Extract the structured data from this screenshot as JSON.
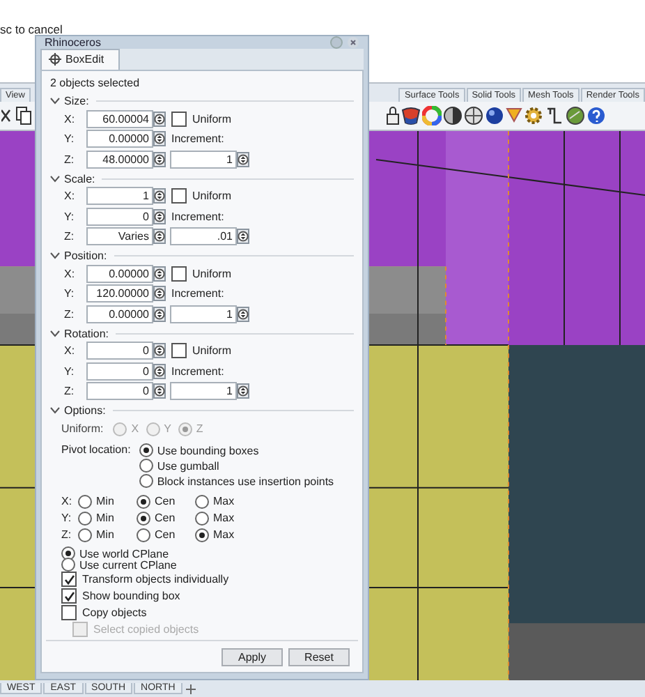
{
  "command_line": {
    "prompt": "sc to cancel"
  },
  "toolbar_tabs": [
    {
      "label": "View",
      "selected": false
    },
    {
      "label": "Surface Tools",
      "selected": false
    },
    {
      "label": "Solid Tools",
      "selected": false
    },
    {
      "label": "Mesh Tools",
      "selected": false
    },
    {
      "label": "Render Tools",
      "selected": false
    }
  ],
  "viewport_tabs": [
    {
      "label": "WEST",
      "selected": false
    },
    {
      "label": "EAST",
      "selected": false
    },
    {
      "label": "SOUTH",
      "selected": false
    },
    {
      "label": "NORTH",
      "selected": false
    }
  ],
  "dialog": {
    "title": "Rhinoceros",
    "tab": "BoxEdit",
    "selection_info": "2 objects selected",
    "sections": [
      {
        "title": "Size:",
        "expanded": true,
        "uniform_label": "Uniform",
        "uniform_checked": false,
        "increment_label": "Increment:",
        "increment": "1",
        "fields": [
          {
            "label": "X:",
            "value": "60.00004"
          },
          {
            "label": "Y:",
            "value": "0.00000"
          },
          {
            "label": "Z:",
            "value": "48.00000"
          }
        ]
      },
      {
        "title": "Scale:",
        "expanded": true,
        "uniform_label": "Uniform",
        "uniform_checked": false,
        "increment_label": "Increment:",
        "increment": ".01",
        "fields": [
          {
            "label": "X:",
            "value": "1"
          },
          {
            "label": "Y:",
            "value": "0"
          },
          {
            "label": "Z:",
            "value": "Varies"
          }
        ]
      },
      {
        "title": "Position:",
        "expanded": true,
        "uniform_label": "Uniform",
        "uniform_checked": false,
        "increment_label": "Increment:",
        "increment": "1",
        "fields": [
          {
            "label": "X:",
            "value": "0.00000"
          },
          {
            "label": "Y:",
            "value": "120.00000"
          },
          {
            "label": "Z:",
            "value": "0.00000"
          }
        ]
      },
      {
        "title": "Rotation:",
        "expanded": true,
        "uniform_label": "Uniform",
        "uniform_checked": false,
        "increment_label": "Increment:",
        "increment": "1",
        "fields": [
          {
            "label": "X:",
            "value": "0"
          },
          {
            "label": "Y:",
            "value": "0"
          },
          {
            "label": "Z:",
            "value": "0"
          }
        ]
      }
    ],
    "options": {
      "title": "Options:",
      "expanded": true,
      "uniform": {
        "label": "Uniform:",
        "disabled": true,
        "choices": [
          {
            "label": "X",
            "selected": false
          },
          {
            "label": "Y",
            "selected": false
          },
          {
            "label": "Z",
            "selected": true
          }
        ]
      },
      "pivot": {
        "label": "Pivot location:",
        "choices": [
          {
            "label": "Use bounding boxes",
            "selected": true
          },
          {
            "label": "Use gumball",
            "selected": false
          },
          {
            "label": "Block instances use insertion points",
            "selected": false
          }
        ]
      },
      "axes": [
        {
          "label": "X:",
          "choices": [
            {
              "label": "Min",
              "selected": false
            },
            {
              "label": "Cen",
              "selected": true
            },
            {
              "label": "Max",
              "selected": false
            }
          ]
        },
        {
          "label": "Y:",
          "choices": [
            {
              "label": "Min",
              "selected": false
            },
            {
              "label": "Cen",
              "selected": true
            },
            {
              "label": "Max",
              "selected": false
            }
          ]
        },
        {
          "label": "Z:",
          "choices": [
            {
              "label": "Min",
              "selected": false
            },
            {
              "label": "Cen",
              "selected": false
            },
            {
              "label": "Max",
              "selected": true
            }
          ]
        }
      ],
      "cplane": [
        {
          "label": "Use world CPlane",
          "selected": true
        },
        {
          "label": "Use current CPlane",
          "selected": false
        }
      ],
      "checkboxes": [
        {
          "label": "Transform objects individually",
          "checked": true,
          "disabled": false
        },
        {
          "label": "Show bounding box",
          "checked": true,
          "disabled": false
        },
        {
          "label": "Copy objects",
          "checked": false,
          "disabled": false,
          "children": [
            {
              "label": "Select copied objects",
              "checked": false,
              "disabled": true
            }
          ]
        }
      ]
    },
    "buttons": [
      "Apply",
      "Reset"
    ]
  }
}
